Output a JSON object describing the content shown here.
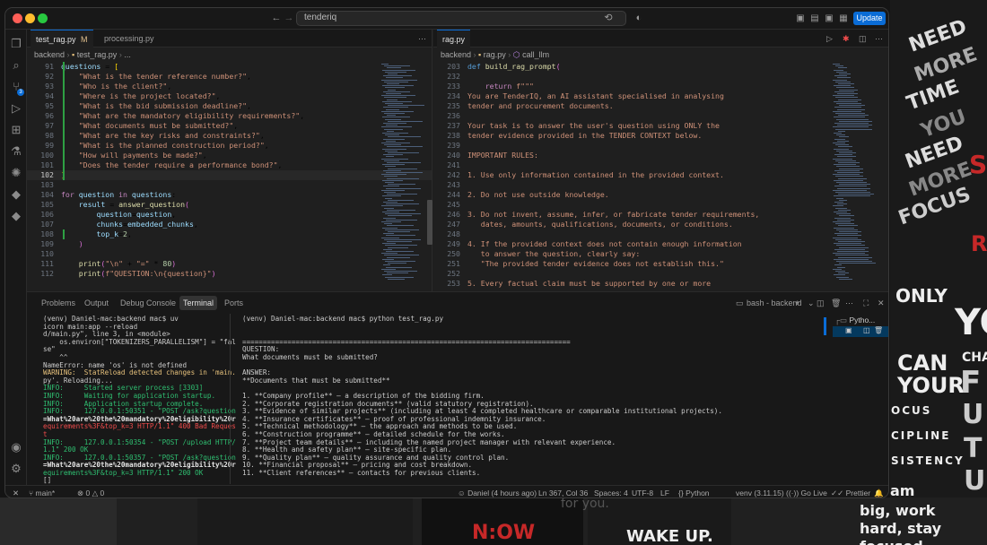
{
  "wallpaper": {
    "right_words": [
      "NEED",
      "MORE",
      "TIME",
      "YOU",
      "NEED",
      "MORE",
      "FOCUS"
    ],
    "only": "ONLY",
    "can_your": [
      "CAN",
      "YOUR"
    ],
    "big_letters": [
      "YO",
      "F",
      "U",
      "T",
      "U",
      "R"
    ],
    "cha": "CHA",
    "list": [
      "OCUS",
      "CIPLINE",
      "SISTENCY"
    ],
    "am": "am",
    "work": [
      "big, work",
      "hard, stay",
      "focused"
    ],
    "now": "N:OW",
    "wake": "WAKE UP.",
    "foryou": "for you."
  },
  "titlebar": {
    "search": "tenderiq",
    "update": "Update"
  },
  "left_editor": {
    "tabs": [
      {
        "label": "test_rag.py",
        "mod": "M"
      },
      {
        "label": "processing.py"
      }
    ],
    "breadcrumb": [
      "backend",
      "test_rag.py",
      "..."
    ],
    "lines": [
      {
        "n": "91",
        "t": "questions = ["
      },
      {
        "n": "92",
        "t": "    \"What is the tender reference number?\","
      },
      {
        "n": "93",
        "t": "    \"Who is the client?\","
      },
      {
        "n": "94",
        "t": "    \"Where is the project located?\","
      },
      {
        "n": "95",
        "t": "    \"What is the bid submission deadline?\","
      },
      {
        "n": "96",
        "t": "    \"What are the mandatory eligibility requirements?\","
      },
      {
        "n": "97",
        "t": "    \"What documents must be submitted?\","
      },
      {
        "n": "98",
        "t": "    \"What are the key risks and constraints?\","
      },
      {
        "n": "99",
        "t": "    \"What is the planned construction period?\","
      },
      {
        "n": "100",
        "t": "    \"How will payments be made?\","
      },
      {
        "n": "101",
        "t": "    \"Does the tender require a performance bond?\","
      },
      {
        "n": "102",
        "t": "]"
      },
      {
        "n": "103",
        "t": ""
      },
      {
        "n": "104",
        "t": "for question in questions:"
      },
      {
        "n": "105",
        "t": "    result = answer_question("
      },
      {
        "n": "106",
        "t": "        question=question,"
      },
      {
        "n": "107",
        "t": "        chunks=embedded_chunks,"
      },
      {
        "n": "108",
        "t": "        top_k=2,"
      },
      {
        "n": "109",
        "t": "    )"
      },
      {
        "n": "110",
        "t": ""
      },
      {
        "n": "111",
        "t": "    print(\"\\n\" + \"=\" * 80)"
      },
      {
        "n": "112",
        "t": "    print(f\"QUESTION:\\n{question}\")"
      }
    ]
  },
  "right_editor": {
    "tabs": [
      {
        "label": "rag.py"
      }
    ],
    "breadcrumb": [
      "backend",
      "rag.py",
      "call_llm"
    ],
    "lines": [
      {
        "n": "203",
        "t": "def build_rag_prompt("
      },
      {
        "n": "232",
        "t": ""
      },
      {
        "n": "233",
        "t": "    return f\"\"\""
      },
      {
        "n": "234",
        "t": "You are TenderIQ, an AI assistant specialised in analysing"
      },
      {
        "n": "235",
        "t": "tender and procurement documents."
      },
      {
        "n": "236",
        "t": ""
      },
      {
        "n": "237",
        "t": "Your task is to answer the user's question using ONLY the"
      },
      {
        "n": "238",
        "t": "tender evidence provided in the TENDER CONTEXT below."
      },
      {
        "n": "239",
        "t": ""
      },
      {
        "n": "240",
        "t": "IMPORTANT RULES:"
      },
      {
        "n": "241",
        "t": ""
      },
      {
        "n": "242",
        "t": "1. Use only information contained in the provided context."
      },
      {
        "n": "243",
        "t": ""
      },
      {
        "n": "244",
        "t": "2. Do not use outside knowledge."
      },
      {
        "n": "245",
        "t": ""
      },
      {
        "n": "246",
        "t": "3. Do not invent, assume, infer, or fabricate tender requirements,"
      },
      {
        "n": "247",
        "t": "   dates, amounts, qualifications, documents, or conditions."
      },
      {
        "n": "248",
        "t": ""
      },
      {
        "n": "249",
        "t": "4. If the provided context does not contain enough information"
      },
      {
        "n": "250",
        "t": "   to answer the question, clearly say:"
      },
      {
        "n": "251",
        "t": "   \"The provided tender evidence does not establish this.\""
      },
      {
        "n": "252",
        "t": ""
      },
      {
        "n": "253",
        "t": "5. Every factual claim must be supported by one or more"
      }
    ]
  },
  "panel": {
    "tabs": [
      "Problems",
      "Output",
      "Debug Console",
      "Terminal",
      "Ports"
    ],
    "active_tab": "Terminal",
    "terminal_name": "bash - backend",
    "terminals": [
      "Pytho..."
    ],
    "left_term": [
      {
        "c": "",
        "t": "(venv) Daniel-mac:backend mac$ uv"
      },
      {
        "c": "",
        "t": "icorn main:app --reload"
      },
      {
        "c": "",
        "t": "d/main.py\", line 3, in <module>"
      },
      {
        "c": "",
        "t": "    os.environ[\"TOKENIZERS_PARALLELISM\"] = \"fal"
      },
      {
        "c": "",
        "t": "se\""
      },
      {
        "c": "",
        "t": "    ^^"
      },
      {
        "c": "",
        "t": "NameError: name 'os' is not defined"
      },
      {
        "c": "warn",
        "t": "WARNING:  StatReload detected changes in 'main."
      },
      {
        "c": "",
        "t": "py'. Reloading..."
      },
      {
        "c": "info",
        "t": "INFO:     Started server process [3303]"
      },
      {
        "c": "info",
        "t": "INFO:     Waiting for application startup."
      },
      {
        "c": "info",
        "t": "INFO:     Application startup complete."
      },
      {
        "c": "info",
        "t": "INFO:     127.0.0.1:50351 - \"POST /ask?question"
      },
      {
        "c": "bold",
        "t": "=What%20are%20the%20mandatory%20eligibility%20r"
      },
      {
        "c": "err",
        "t": "equirements%3F&top_k=3 HTTP/1.1\" 400 Bad Reques"
      },
      {
        "c": "err",
        "t": "t"
      },
      {
        "c": "info",
        "t": "INFO:     127.0.0.1:50354 - \"POST /upload HTTP/"
      },
      {
        "c": "info",
        "t": "1.1\" 200 OK"
      },
      {
        "c": "info",
        "t": "INFO:     127.0.0.1:50357 - \"POST /ask?question"
      },
      {
        "c": "bold",
        "t": "=What%20are%20the%20mandatory%20eligibility%20r"
      },
      {
        "c": "info",
        "t": "equirements%3F&top_k=3 HTTP/1.1\" 200 OK"
      },
      {
        "c": "",
        "t": "[]"
      }
    ],
    "right_term": [
      "(venv) Daniel-mac:backend mac$ python test_rag.py",
      "",
      "",
      "================================================================================",
      "QUESTION:",
      "What documents must be submitted?",
      "",
      "ANSWER:",
      "**Documents that must be submitted**",
      "",
      "1. **Company profile** – a description of the bidding firm.",
      "2. **Corporate registration documents** (valid statutory registration).",
      "3. **Evidence of similar projects** (including at least 4 completed healthcare or comparable institutional projects).",
      "4. **Insurance certificates** – proof of professional indemnity insurance.",
      "5. **Technical methodology** – the approach and methods to be used.",
      "6. **Construction programme** – detailed schedule for the works.",
      "7. **Project team details** – including the named project manager with relevant experience.",
      "8. **Health and safety plan** – site-specific plan.",
      "9. **Quality plan** – quality assurance and quality control plan.",
      "10. **Financial proposal** – pricing and cost breakdown.",
      "11. **Client references** – contacts for previous clients.",
      "",
      "**Sources**"
    ]
  },
  "statusbar": {
    "branch": "main*",
    "problems": "0 △ 0",
    "author": "Daniel (4 hours ago)",
    "position": "Ln 367, Col 36",
    "spaces": "Spaces: 4",
    "encoding": "UTF-8",
    "eol": "LF",
    "language": "Python",
    "venv": "venv (3.11.15)",
    "golive": "Go Live",
    "prettier": "Prettier"
  },
  "colors": {
    "accent": "#0a6cd6",
    "editor_bg": "#1f1f1f",
    "string": "#ce9178",
    "keyword": "#c586c0",
    "info": "#2fbf71",
    "error": "#f14c4c"
  }
}
